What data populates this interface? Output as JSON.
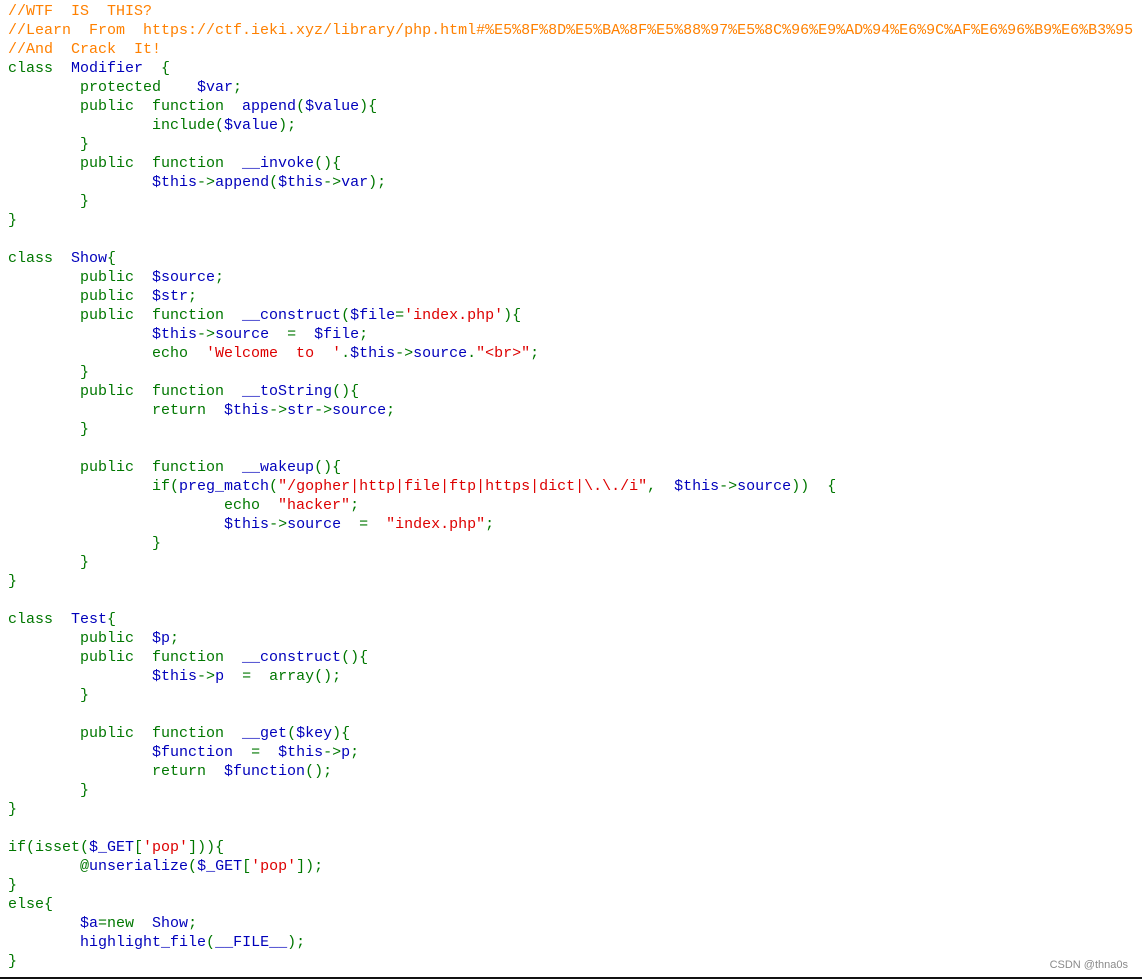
{
  "colors": {
    "comment": "#FF8000",
    "keyword": "#007700",
    "default": "#0000BB",
    "string": "#DD0000",
    "background": "#FFFFFF"
  },
  "code_lines": [
    [
      [
        "comment",
        "//WTF  IS  THIS?"
      ]
    ],
    [
      [
        "comment",
        "//Learn  From  https://ctf.ieki.xyz/library/php.html#%E5%8F%8D%E5%BA%8F%E5%88%97%E5%8C%96%E9%AD%94%E6%9C%AF%E6%96%B9%E6%B3%95"
      ]
    ],
    [
      [
        "comment",
        "//And  Crack  It!"
      ]
    ],
    [
      [
        "keyword",
        "class  "
      ],
      [
        "default",
        "Modifier  "
      ],
      [
        "keyword",
        "{"
      ]
    ],
    [
      [
        "keyword",
        "        protected    "
      ],
      [
        "default",
        "$var"
      ],
      [
        "keyword",
        ";"
      ]
    ],
    [
      [
        "keyword",
        "        public  function  "
      ],
      [
        "default",
        "append"
      ],
      [
        "keyword",
        "("
      ],
      [
        "default",
        "$value"
      ],
      [
        "keyword",
        "){"
      ]
    ],
    [
      [
        "keyword",
        "                include("
      ],
      [
        "default",
        "$value"
      ],
      [
        "keyword",
        ");"
      ]
    ],
    [
      [
        "keyword",
        "        }"
      ]
    ],
    [
      [
        "keyword",
        "        public  function  "
      ],
      [
        "default",
        "__invoke"
      ],
      [
        "keyword",
        "(){"
      ]
    ],
    [
      [
        "keyword",
        "                "
      ],
      [
        "default",
        "$this"
      ],
      [
        "keyword",
        "->"
      ],
      [
        "default",
        "append"
      ],
      [
        "keyword",
        "("
      ],
      [
        "default",
        "$this"
      ],
      [
        "keyword",
        "->"
      ],
      [
        "default",
        "var"
      ],
      [
        "keyword",
        ");"
      ]
    ],
    [
      [
        "keyword",
        "        }"
      ]
    ],
    [
      [
        "keyword",
        "}"
      ]
    ],
    [],
    [
      [
        "keyword",
        "class  "
      ],
      [
        "default",
        "Show"
      ],
      [
        "keyword",
        "{"
      ]
    ],
    [
      [
        "keyword",
        "        public  "
      ],
      [
        "default",
        "$source"
      ],
      [
        "keyword",
        ";"
      ]
    ],
    [
      [
        "keyword",
        "        public  "
      ],
      [
        "default",
        "$str"
      ],
      [
        "keyword",
        ";"
      ]
    ],
    [
      [
        "keyword",
        "        public  function  "
      ],
      [
        "default",
        "__construct"
      ],
      [
        "keyword",
        "("
      ],
      [
        "default",
        "$file"
      ],
      [
        "keyword",
        "="
      ],
      [
        "string",
        "'index.php'"
      ],
      [
        "keyword",
        "){"
      ]
    ],
    [
      [
        "keyword",
        "                "
      ],
      [
        "default",
        "$this"
      ],
      [
        "keyword",
        "->"
      ],
      [
        "default",
        "source  "
      ],
      [
        "keyword",
        "=  "
      ],
      [
        "default",
        "$file"
      ],
      [
        "keyword",
        ";"
      ]
    ],
    [
      [
        "keyword",
        "                echo  "
      ],
      [
        "string",
        "'Welcome  to  '"
      ],
      [
        "keyword",
        "."
      ],
      [
        "default",
        "$this"
      ],
      [
        "keyword",
        "->"
      ],
      [
        "default",
        "source"
      ],
      [
        "keyword",
        "."
      ],
      [
        "string",
        "\"<br>\""
      ],
      [
        "keyword",
        ";"
      ]
    ],
    [
      [
        "keyword",
        "        }"
      ]
    ],
    [
      [
        "keyword",
        "        public  function  "
      ],
      [
        "default",
        "__toString"
      ],
      [
        "keyword",
        "(){"
      ]
    ],
    [
      [
        "keyword",
        "                return  "
      ],
      [
        "default",
        "$this"
      ],
      [
        "keyword",
        "->"
      ],
      [
        "default",
        "str"
      ],
      [
        "keyword",
        "->"
      ],
      [
        "default",
        "source"
      ],
      [
        "keyword",
        ";"
      ]
    ],
    [
      [
        "keyword",
        "        }"
      ]
    ],
    [],
    [
      [
        "keyword",
        "        public  function  "
      ],
      [
        "default",
        "__wakeup"
      ],
      [
        "keyword",
        "(){"
      ]
    ],
    [
      [
        "keyword",
        "                if("
      ],
      [
        "default",
        "preg_match"
      ],
      [
        "keyword",
        "("
      ],
      [
        "string",
        "\"/gopher|http|file|ftp|https|dict|\\.\\./i\""
      ],
      [
        "keyword",
        ",  "
      ],
      [
        "default",
        "$this"
      ],
      [
        "keyword",
        "->"
      ],
      [
        "default",
        "source"
      ],
      [
        "keyword",
        "))  {"
      ]
    ],
    [
      [
        "keyword",
        "                        echo  "
      ],
      [
        "string",
        "\"hacker\""
      ],
      [
        "keyword",
        ";"
      ]
    ],
    [
      [
        "keyword",
        "                        "
      ],
      [
        "default",
        "$this"
      ],
      [
        "keyword",
        "->"
      ],
      [
        "default",
        "source  "
      ],
      [
        "keyword",
        "=  "
      ],
      [
        "string",
        "\"index.php\""
      ],
      [
        "keyword",
        ";"
      ]
    ],
    [
      [
        "keyword",
        "                }"
      ]
    ],
    [
      [
        "keyword",
        "        }"
      ]
    ],
    [
      [
        "keyword",
        "}"
      ]
    ],
    [],
    [
      [
        "keyword",
        "class  "
      ],
      [
        "default",
        "Test"
      ],
      [
        "keyword",
        "{"
      ]
    ],
    [
      [
        "keyword",
        "        public  "
      ],
      [
        "default",
        "$p"
      ],
      [
        "keyword",
        ";"
      ]
    ],
    [
      [
        "keyword",
        "        public  function  "
      ],
      [
        "default",
        "__construct"
      ],
      [
        "keyword",
        "(){"
      ]
    ],
    [
      [
        "keyword",
        "                "
      ],
      [
        "default",
        "$this"
      ],
      [
        "keyword",
        "->"
      ],
      [
        "default",
        "p  "
      ],
      [
        "keyword",
        "=  array();"
      ]
    ],
    [
      [
        "keyword",
        "        }"
      ]
    ],
    [],
    [
      [
        "keyword",
        "        public  function  "
      ],
      [
        "default",
        "__get"
      ],
      [
        "keyword",
        "("
      ],
      [
        "default",
        "$key"
      ],
      [
        "keyword",
        "){"
      ]
    ],
    [
      [
        "keyword",
        "                "
      ],
      [
        "default",
        "$function  "
      ],
      [
        "keyword",
        "=  "
      ],
      [
        "default",
        "$this"
      ],
      [
        "keyword",
        "->"
      ],
      [
        "default",
        "p"
      ],
      [
        "keyword",
        ";"
      ]
    ],
    [
      [
        "keyword",
        "                return  "
      ],
      [
        "default",
        "$function"
      ],
      [
        "keyword",
        "();"
      ]
    ],
    [
      [
        "keyword",
        "        }"
      ]
    ],
    [
      [
        "keyword",
        "}"
      ]
    ],
    [],
    [
      [
        "keyword",
        "if(isset("
      ],
      [
        "default",
        "$_GET"
      ],
      [
        "keyword",
        "["
      ],
      [
        "string",
        "'pop'"
      ],
      [
        "keyword",
        "])){"
      ]
    ],
    [
      [
        "keyword",
        "        @"
      ],
      [
        "default",
        "unserialize"
      ],
      [
        "keyword",
        "("
      ],
      [
        "default",
        "$_GET"
      ],
      [
        "keyword",
        "["
      ],
      [
        "string",
        "'pop'"
      ],
      [
        "keyword",
        "]);"
      ]
    ],
    [
      [
        "keyword",
        "}"
      ]
    ],
    [
      [
        "keyword",
        "else{"
      ]
    ],
    [
      [
        "keyword",
        "        "
      ],
      [
        "default",
        "$a"
      ],
      [
        "keyword",
        "=new  "
      ],
      [
        "default",
        "Show"
      ],
      [
        "keyword",
        ";"
      ]
    ],
    [
      [
        "keyword",
        "        "
      ],
      [
        "default",
        "highlight_file"
      ],
      [
        "keyword",
        "("
      ],
      [
        "default",
        "__FILE__"
      ],
      [
        "keyword",
        ");"
      ]
    ],
    [
      [
        "keyword",
        "}"
      ]
    ]
  ],
  "watermark": "CSDN @thna0s"
}
